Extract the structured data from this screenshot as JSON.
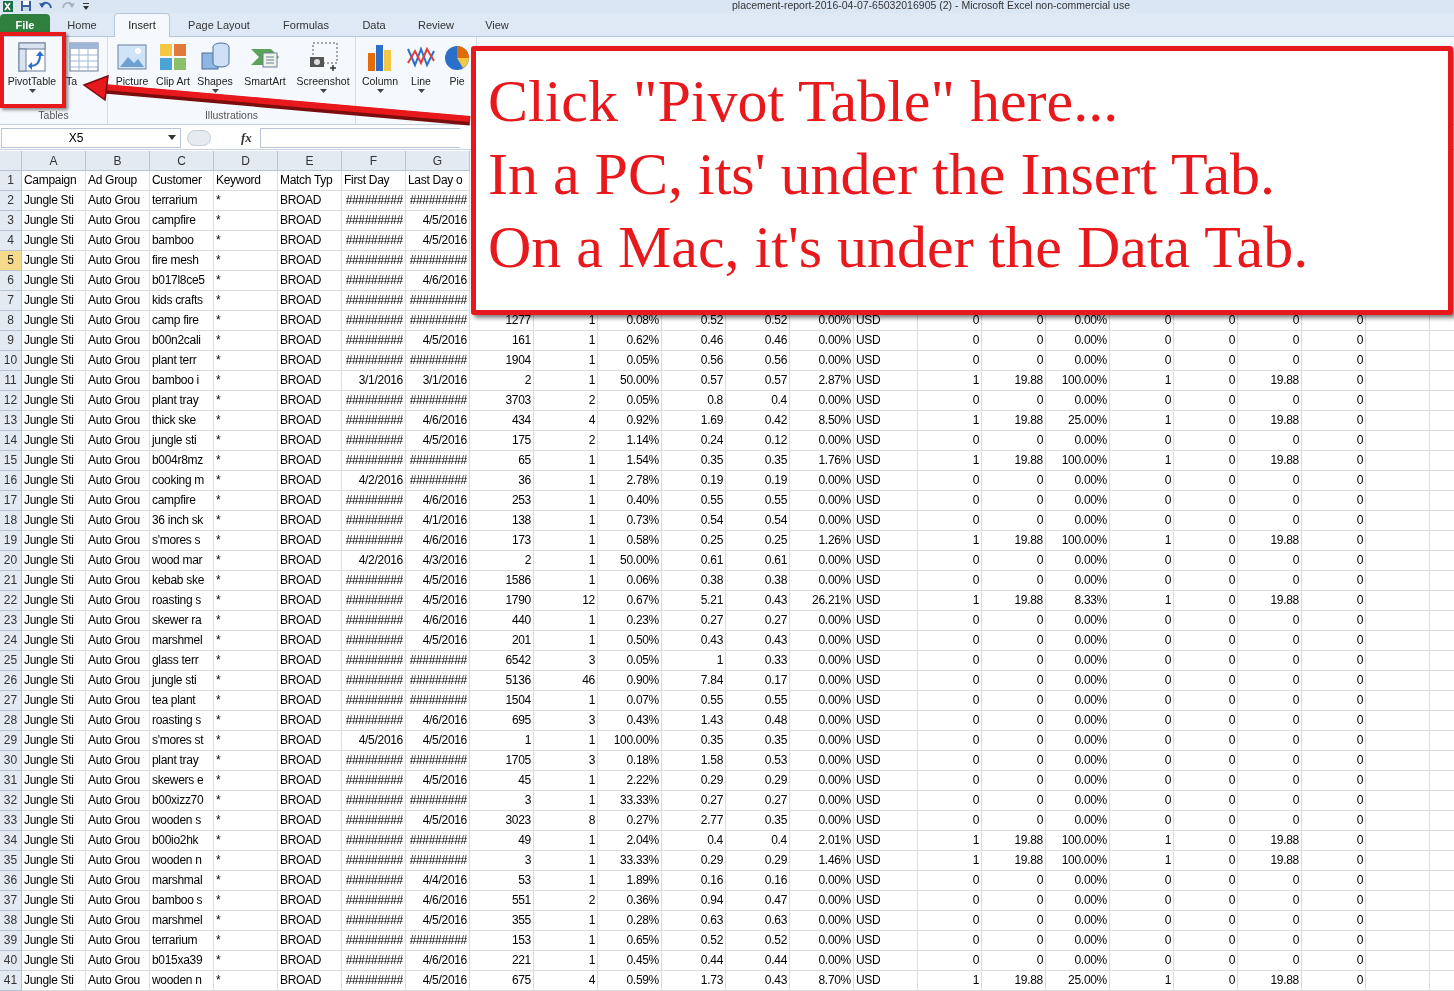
{
  "window": {
    "title": "placement-report-2016-04-07-65032016905 (2)  -  Microsoft Excel non-commercial use"
  },
  "ribbon_tabs": [
    {
      "label": "File",
      "kind": "file",
      "selected": false
    },
    {
      "label": "Home",
      "kind": "tab",
      "selected": false
    },
    {
      "label": "Insert",
      "kind": "tab",
      "selected": true
    },
    {
      "label": "Page Layout",
      "kind": "tab",
      "selected": false
    },
    {
      "label": "Formulas",
      "kind": "tab",
      "selected": false
    },
    {
      "label": "Data",
      "kind": "tab",
      "selected": false
    },
    {
      "label": "Review",
      "kind": "tab",
      "selected": false
    },
    {
      "label": "View",
      "kind": "tab",
      "selected": false
    }
  ],
  "ribbon_groups": [
    {
      "label": "Tables",
      "buttons": [
        {
          "label": "PivotTable",
          "kind": "pivot",
          "dropdown": true
        },
        {
          "label": "Ta",
          "kind": "table",
          "dropdown": false
        }
      ]
    },
    {
      "label": "Illustrations",
      "buttons": [
        {
          "label": "Picture",
          "kind": "picture",
          "dropdown": false
        },
        {
          "label": "Clip Art",
          "kind": "clipart",
          "dropdown": false
        },
        {
          "label": "Shapes",
          "kind": "shapes",
          "dropdown": true
        },
        {
          "label": "SmartArt",
          "kind": "smartart",
          "dropdown": false
        },
        {
          "label": "Screenshot",
          "kind": "screenshot",
          "dropdown": true
        }
      ]
    },
    {
      "buttons": [
        {
          "label": "Column",
          "kind": "column",
          "dropdown": true
        },
        {
          "label": "Line",
          "kind": "line",
          "dropdown": true
        },
        {
          "label": "Pie",
          "kind": "pie",
          "dropdown": false
        }
      ]
    }
  ],
  "formula_bar": {
    "name_box": "X5",
    "fx": "fx"
  },
  "columns": [
    "A",
    "B",
    "C",
    "D",
    "E",
    "F",
    "G"
  ],
  "rows": [
    {
      "number": "1",
      "kind": "header",
      "selected": false,
      "cells": [
        "Campaign",
        "Ad Group",
        "Customer",
        "Keyword",
        "Match Typ",
        "First Day",
        "Last Day o"
      ]
    },
    {
      "number": "2",
      "kind": "data",
      "selected": false,
      "cells": [
        "Jungle Sti",
        "Auto Grou",
        "terrarium",
        "*",
        "BROAD",
        "#########",
        "#########"
      ]
    },
    {
      "number": "3",
      "kind": "data",
      "selected": false,
      "cells": [
        "Jungle Sti",
        "Auto Grou",
        "campfire",
        "*",
        "BROAD",
        "#########",
        "4/5/2016"
      ]
    },
    {
      "number": "4",
      "kind": "data",
      "selected": false,
      "cells": [
        "Jungle Sti",
        "Auto Grou",
        "bamboo",
        "*",
        "BROAD",
        "#########",
        "4/5/2016"
      ]
    },
    {
      "number": "5",
      "kind": "data",
      "selected": true,
      "cells": [
        "Jungle Sti",
        "Auto Grou",
        "fire mesh",
        "*",
        "BROAD",
        "#########",
        "#########"
      ]
    },
    {
      "number": "6",
      "kind": "data",
      "selected": false,
      "cells": [
        "Jungle Sti",
        "Auto Grou",
        "b017l8ce5",
        "*",
        "BROAD",
        "#########",
        "4/6/2016"
      ]
    },
    {
      "number": "7",
      "kind": "data",
      "selected": false,
      "cells": [
        "Jungle Sti",
        "Auto Grou",
        "kids crafts",
        "*",
        "BROAD",
        "#########",
        "#########"
      ]
    },
    {
      "number": "8",
      "kind": "data",
      "selected": false,
      "cells": [
        "Jungle Sti",
        "Auto Grou",
        "camp fire",
        "*",
        "BROAD",
        "#########",
        "#########",
        "1277",
        "1",
        "0.08%",
        "0.52",
        "0.52",
        "0.00%",
        "USD",
        "0",
        "0",
        "0.00%",
        "0",
        "0",
        "0",
        "0"
      ]
    },
    {
      "number": "9",
      "kind": "data",
      "selected": false,
      "cells": [
        "Jungle Sti",
        "Auto Grou",
        "b00n2cali",
        "*",
        "BROAD",
        "#########",
        "4/5/2016",
        "161",
        "1",
        "0.62%",
        "0.46",
        "0.46",
        "0.00%",
        "USD",
        "0",
        "0",
        "0.00%",
        "0",
        "0",
        "0",
        "0"
      ]
    },
    {
      "number": "10",
      "kind": "data",
      "selected": false,
      "cells": [
        "Jungle Sti",
        "Auto Grou",
        "plant terr",
        "*",
        "BROAD",
        "#########",
        "#########",
        "1904",
        "1",
        "0.05%",
        "0.56",
        "0.56",
        "0.00%",
        "USD",
        "0",
        "0",
        "0.00%",
        "0",
        "0",
        "0",
        "0"
      ]
    },
    {
      "number": "11",
      "kind": "data",
      "selected": false,
      "cells": [
        "Jungle Sti",
        "Auto Grou",
        "bamboo i",
        "*",
        "BROAD",
        "3/1/2016",
        "3/1/2016",
        "2",
        "1",
        "50.00%",
        "0.57",
        "0.57",
        "2.87%",
        "USD",
        "1",
        "19.88",
        "100.00%",
        "1",
        "0",
        "19.88",
        "0"
      ]
    },
    {
      "number": "12",
      "kind": "data",
      "selected": false,
      "cells": [
        "Jungle Sti",
        "Auto Grou",
        "plant tray",
        "*",
        "BROAD",
        "#########",
        "#########",
        "3703",
        "2",
        "0.05%",
        "0.8",
        "0.4",
        "0.00%",
        "USD",
        "0",
        "0",
        "0.00%",
        "0",
        "0",
        "0",
        "0"
      ]
    },
    {
      "number": "13",
      "kind": "data",
      "selected": false,
      "cells": [
        "Jungle Sti",
        "Auto Grou",
        "thick ske",
        "*",
        "BROAD",
        "#########",
        "4/6/2016",
        "434",
        "4",
        "0.92%",
        "1.69",
        "0.42",
        "8.50%",
        "USD",
        "1",
        "19.88",
        "25.00%",
        "1",
        "0",
        "19.88",
        "0"
      ]
    },
    {
      "number": "14",
      "kind": "data",
      "selected": false,
      "cells": [
        "Jungle Sti",
        "Auto Grou",
        "jungle sti",
        "*",
        "BROAD",
        "#########",
        "4/5/2016",
        "175",
        "2",
        "1.14%",
        "0.24",
        "0.12",
        "0.00%",
        "USD",
        "0",
        "0",
        "0.00%",
        "0",
        "0",
        "0",
        "0"
      ]
    },
    {
      "number": "15",
      "kind": "data",
      "selected": false,
      "cells": [
        "Jungle Sti",
        "Auto Grou",
        "b004r8mz",
        "*",
        "BROAD",
        "#########",
        "#########",
        "65",
        "1",
        "1.54%",
        "0.35",
        "0.35",
        "1.76%",
        "USD",
        "1",
        "19.88",
        "100.00%",
        "1",
        "0",
        "19.88",
        "0"
      ]
    },
    {
      "number": "16",
      "kind": "data",
      "selected": false,
      "cells": [
        "Jungle Sti",
        "Auto Grou",
        "cooking m",
        "*",
        "BROAD",
        "4/2/2016",
        "#########",
        "36",
        "1",
        "2.78%",
        "0.19",
        "0.19",
        "0.00%",
        "USD",
        "0",
        "0",
        "0.00%",
        "0",
        "0",
        "0",
        "0"
      ]
    },
    {
      "number": "17",
      "kind": "data",
      "selected": false,
      "cells": [
        "Jungle Sti",
        "Auto Grou",
        "campfire",
        "*",
        "BROAD",
        "#########",
        "4/6/2016",
        "253",
        "1",
        "0.40%",
        "0.55",
        "0.55",
        "0.00%",
        "USD",
        "0",
        "0",
        "0.00%",
        "0",
        "0",
        "0",
        "0"
      ]
    },
    {
      "number": "18",
      "kind": "data",
      "selected": false,
      "cells": [
        "Jungle Sti",
        "Auto Grou",
        "36 inch sk",
        "*",
        "BROAD",
        "#########",
        "4/1/2016",
        "138",
        "1",
        "0.73%",
        "0.54",
        "0.54",
        "0.00%",
        "USD",
        "0",
        "0",
        "0.00%",
        "0",
        "0",
        "0",
        "0"
      ]
    },
    {
      "number": "19",
      "kind": "data",
      "selected": false,
      "cells": [
        "Jungle Sti",
        "Auto Grou",
        "s'mores s",
        "*",
        "BROAD",
        "#########",
        "4/6/2016",
        "173",
        "1",
        "0.58%",
        "0.25",
        "0.25",
        "1.26%",
        "USD",
        "1",
        "19.88",
        "100.00%",
        "1",
        "0",
        "19.88",
        "0"
      ]
    },
    {
      "number": "20",
      "kind": "data",
      "selected": false,
      "cells": [
        "Jungle Sti",
        "Auto Grou",
        "wood mar",
        "*",
        "BROAD",
        "4/2/2016",
        "4/3/2016",
        "2",
        "1",
        "50.00%",
        "0.61",
        "0.61",
        "0.00%",
        "USD",
        "0",
        "0",
        "0.00%",
        "0",
        "0",
        "0",
        "0"
      ]
    },
    {
      "number": "21",
      "kind": "data",
      "selected": false,
      "cells": [
        "Jungle Sti",
        "Auto Grou",
        "kebab ske",
        "*",
        "BROAD",
        "#########",
        "4/5/2016",
        "1586",
        "1",
        "0.06%",
        "0.38",
        "0.38",
        "0.00%",
        "USD",
        "0",
        "0",
        "0.00%",
        "0",
        "0",
        "0",
        "0"
      ]
    },
    {
      "number": "22",
      "kind": "data",
      "selected": false,
      "cells": [
        "Jungle Sti",
        "Auto Grou",
        "roasting s",
        "*",
        "BROAD",
        "#########",
        "4/5/2016",
        "1790",
        "12",
        "0.67%",
        "5.21",
        "0.43",
        "26.21%",
        "USD",
        "1",
        "19.88",
        "8.33%",
        "1",
        "0",
        "19.88",
        "0"
      ]
    },
    {
      "number": "23",
      "kind": "data",
      "selected": false,
      "cells": [
        "Jungle Sti",
        "Auto Grou",
        "skewer ra",
        "*",
        "BROAD",
        "#########",
        "4/6/2016",
        "440",
        "1",
        "0.23%",
        "0.27",
        "0.27",
        "0.00%",
        "USD",
        "0",
        "0",
        "0.00%",
        "0",
        "0",
        "0",
        "0"
      ]
    },
    {
      "number": "24",
      "kind": "data",
      "selected": false,
      "cells": [
        "Jungle Sti",
        "Auto Grou",
        "marshmel",
        "*",
        "BROAD",
        "#########",
        "4/5/2016",
        "201",
        "1",
        "0.50%",
        "0.43",
        "0.43",
        "0.00%",
        "USD",
        "0",
        "0",
        "0.00%",
        "0",
        "0",
        "0",
        "0"
      ]
    },
    {
      "number": "25",
      "kind": "data",
      "selected": false,
      "cells": [
        "Jungle Sti",
        "Auto Grou",
        "glass terr",
        "*",
        "BROAD",
        "#########",
        "#########",
        "6542",
        "3",
        "0.05%",
        "1",
        "0.33",
        "0.00%",
        "USD",
        "0",
        "0",
        "0.00%",
        "0",
        "0",
        "0",
        "0"
      ]
    },
    {
      "number": "26",
      "kind": "data",
      "selected": false,
      "cells": [
        "Jungle Sti",
        "Auto Grou",
        "jungle sti",
        "*",
        "BROAD",
        "#########",
        "#########",
        "5136",
        "46",
        "0.90%",
        "7.84",
        "0.17",
        "0.00%",
        "USD",
        "0",
        "0",
        "0.00%",
        "0",
        "0",
        "0",
        "0"
      ]
    },
    {
      "number": "27",
      "kind": "data",
      "selected": false,
      "cells": [
        "Jungle Sti",
        "Auto Grou",
        "tea plant",
        "*",
        "BROAD",
        "#########",
        "#########",
        "1504",
        "1",
        "0.07%",
        "0.55",
        "0.55",
        "0.00%",
        "USD",
        "0",
        "0",
        "0.00%",
        "0",
        "0",
        "0",
        "0"
      ]
    },
    {
      "number": "28",
      "kind": "data",
      "selected": false,
      "cells": [
        "Jungle Sti",
        "Auto Grou",
        "roasting s",
        "*",
        "BROAD",
        "#########",
        "4/6/2016",
        "695",
        "3",
        "0.43%",
        "1.43",
        "0.48",
        "0.00%",
        "USD",
        "0",
        "0",
        "0.00%",
        "0",
        "0",
        "0",
        "0"
      ]
    },
    {
      "number": "29",
      "kind": "data",
      "selected": false,
      "cells": [
        "Jungle Sti",
        "Auto Grou",
        "s'mores st",
        "*",
        "BROAD",
        "4/5/2016",
        "4/5/2016",
        "1",
        "1",
        "100.00%",
        "0.35",
        "0.35",
        "0.00%",
        "USD",
        "0",
        "0",
        "0.00%",
        "0",
        "0",
        "0",
        "0"
      ]
    },
    {
      "number": "30",
      "kind": "data",
      "selected": false,
      "cells": [
        "Jungle Sti",
        "Auto Grou",
        "plant tray",
        "*",
        "BROAD",
        "#########",
        "#########",
        "1705",
        "3",
        "0.18%",
        "1.58",
        "0.53",
        "0.00%",
        "USD",
        "0",
        "0",
        "0.00%",
        "0",
        "0",
        "0",
        "0"
      ]
    },
    {
      "number": "31",
      "kind": "data",
      "selected": false,
      "cells": [
        "Jungle Sti",
        "Auto Grou",
        "skewers e",
        "*",
        "BROAD",
        "#########",
        "4/5/2016",
        "45",
        "1",
        "2.22%",
        "0.29",
        "0.29",
        "0.00%",
        "USD",
        "0",
        "0",
        "0.00%",
        "0",
        "0",
        "0",
        "0"
      ]
    },
    {
      "number": "32",
      "kind": "data",
      "selected": false,
      "cells": [
        "Jungle Sti",
        "Auto Grou",
        "b00xizz70",
        "*",
        "BROAD",
        "#########",
        "#########",
        "3",
        "1",
        "33.33%",
        "0.27",
        "0.27",
        "0.00%",
        "USD",
        "0",
        "0",
        "0.00%",
        "0",
        "0",
        "0",
        "0"
      ]
    },
    {
      "number": "33",
      "kind": "data",
      "selected": false,
      "cells": [
        "Jungle Sti",
        "Auto Grou",
        "wooden s",
        "*",
        "BROAD",
        "#########",
        "4/5/2016",
        "3023",
        "8",
        "0.27%",
        "2.77",
        "0.35",
        "0.00%",
        "USD",
        "0",
        "0",
        "0.00%",
        "0",
        "0",
        "0",
        "0"
      ]
    },
    {
      "number": "34",
      "kind": "data",
      "selected": false,
      "cells": [
        "Jungle Sti",
        "Auto Grou",
        "b00io2hk",
        "*",
        "BROAD",
        "#########",
        "#########",
        "49",
        "1",
        "2.04%",
        "0.4",
        "0.4",
        "2.01%",
        "USD",
        "1",
        "19.88",
        "100.00%",
        "1",
        "0",
        "19.88",
        "0"
      ]
    },
    {
      "number": "35",
      "kind": "data",
      "selected": false,
      "cells": [
        "Jungle Sti",
        "Auto Grou",
        "wooden n",
        "*",
        "BROAD",
        "#########",
        "#########",
        "3",
        "1",
        "33.33%",
        "0.29",
        "0.29",
        "1.46%",
        "USD",
        "1",
        "19.88",
        "100.00%",
        "1",
        "0",
        "19.88",
        "0"
      ]
    },
    {
      "number": "36",
      "kind": "data",
      "selected": false,
      "cells": [
        "Jungle Sti",
        "Auto Grou",
        "marshmal",
        "*",
        "BROAD",
        "#########",
        "4/4/2016",
        "53",
        "1",
        "1.89%",
        "0.16",
        "0.16",
        "0.00%",
        "USD",
        "0",
        "0",
        "0.00%",
        "0",
        "0",
        "0",
        "0"
      ]
    },
    {
      "number": "37",
      "kind": "data",
      "selected": false,
      "cells": [
        "Jungle Sti",
        "Auto Grou",
        "bamboo s",
        "*",
        "BROAD",
        "#########",
        "4/6/2016",
        "551",
        "2",
        "0.36%",
        "0.94",
        "0.47",
        "0.00%",
        "USD",
        "0",
        "0",
        "0.00%",
        "0",
        "0",
        "0",
        "0"
      ]
    },
    {
      "number": "38",
      "kind": "data",
      "selected": false,
      "cells": [
        "Jungle Sti",
        "Auto Grou",
        "marshmel",
        "*",
        "BROAD",
        "#########",
        "4/5/2016",
        "355",
        "1",
        "0.28%",
        "0.63",
        "0.63",
        "0.00%",
        "USD",
        "0",
        "0",
        "0.00%",
        "0",
        "0",
        "0",
        "0"
      ]
    },
    {
      "number": "39",
      "kind": "data",
      "selected": false,
      "cells": [
        "Jungle Sti",
        "Auto Grou",
        "terrarium",
        "*",
        "BROAD",
        "#########",
        "#########",
        "153",
        "1",
        "0.65%",
        "0.52",
        "0.52",
        "0.00%",
        "USD",
        "0",
        "0",
        "0.00%",
        "0",
        "0",
        "0",
        "0"
      ]
    },
    {
      "number": "40",
      "kind": "data",
      "selected": false,
      "cells": [
        "Jungle Sti",
        "Auto Grou",
        "b015xa39",
        "*",
        "BROAD",
        "#########",
        "4/6/2016",
        "221",
        "1",
        "0.45%",
        "0.44",
        "0.44",
        "0.00%",
        "USD",
        "0",
        "0",
        "0.00%",
        "0",
        "0",
        "0",
        "0"
      ]
    },
    {
      "number": "41",
      "kind": "data",
      "selected": false,
      "cells": [
        "Jungle Sti",
        "Auto Grou",
        "wooden n",
        "*",
        "BROAD",
        "#########",
        "4/5/2016",
        "675",
        "4",
        "0.59%",
        "1.73",
        "0.43",
        "8.70%",
        "USD",
        "1",
        "19.88",
        "25.00%",
        "1",
        "0",
        "19.88",
        "0"
      ]
    }
  ],
  "callout": {
    "lines": [
      "Click \"Pivot Table\" here...",
      "In a PC, its' under the Insert Tab.",
      "On a Mac, it's under the Data Tab."
    ]
  }
}
